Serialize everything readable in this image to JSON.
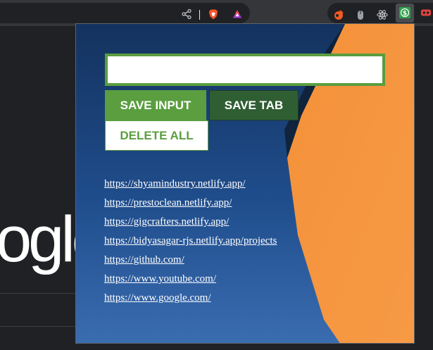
{
  "browser": {
    "icons": [
      "share-icon",
      "brave-shields-icon",
      "brave-rewards-icon"
    ],
    "extensions": [
      "fire-extension-icon",
      "mouse-extension-icon",
      "react-devtools-icon",
      "dollar-extension-icon",
      "vr-extension-icon"
    ]
  },
  "page": {
    "logo_text": "ogle"
  },
  "popup": {
    "input_value": "",
    "save_input_label": "SAVE INPUT",
    "save_tab_label": "SAVE TAB",
    "delete_all_label": "DELETE ALL",
    "links": [
      "https://shyamindustry.netlify.app/",
      "https://prestoclean.netlify.app/",
      "https://gigcrafters.netlify.app/",
      "https://bidyasagar-rjs.netlify.app/projects",
      "https://github.com/",
      "https://www.youtube.com/",
      "https://www.google.com/"
    ]
  },
  "colors": {
    "accent_green": "#5a9e3f",
    "dark_green": "#2f5e33",
    "orange": "#f4913a",
    "blue": "#1f4d8c"
  }
}
